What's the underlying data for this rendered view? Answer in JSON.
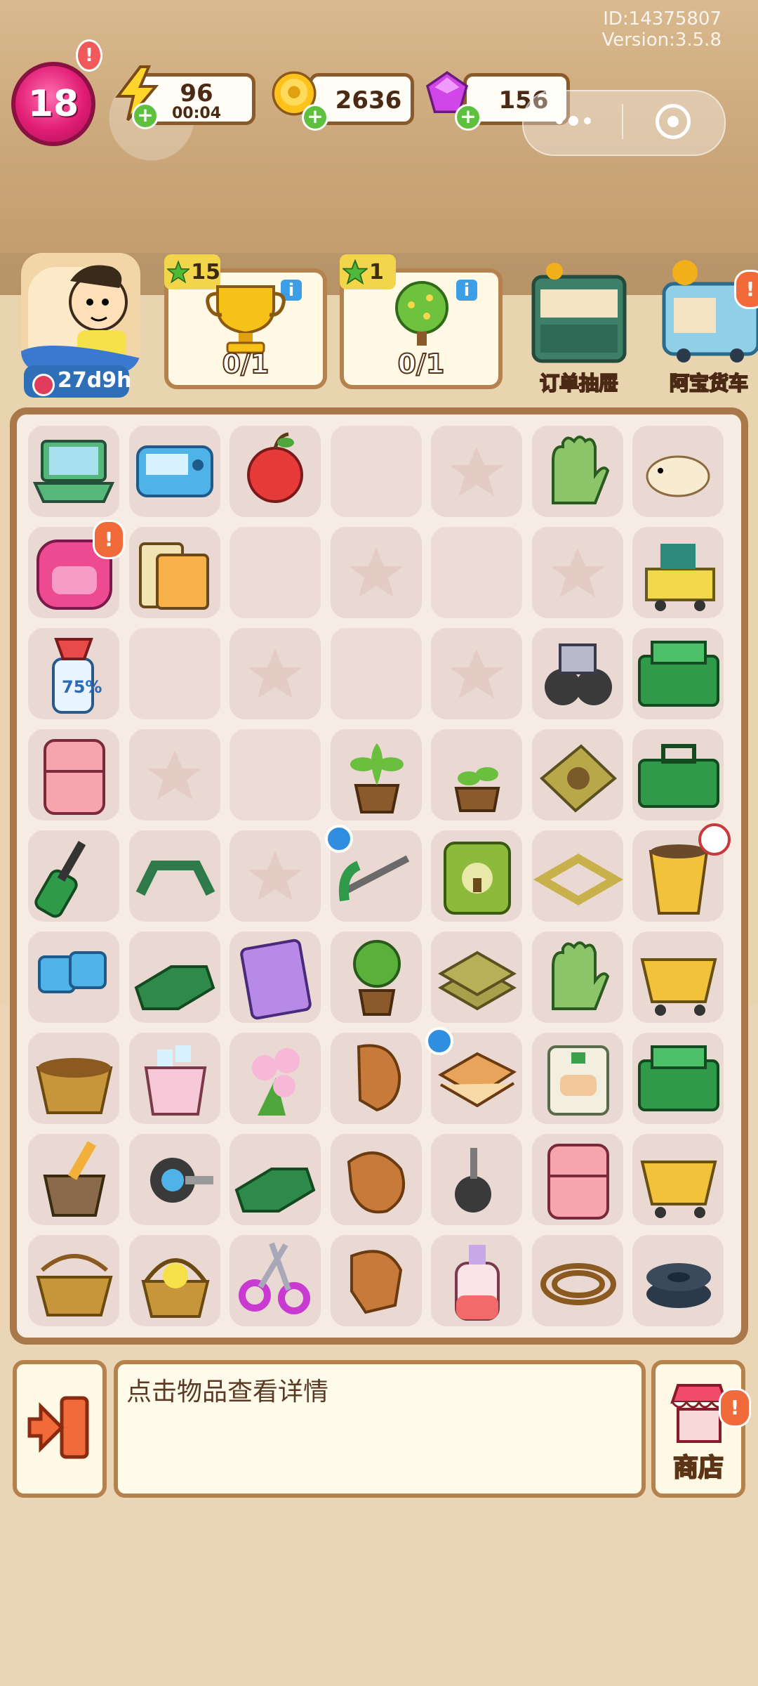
{
  "header": {
    "id_text": "ID:14375807",
    "version_text": "Version:3.5.8",
    "level": "18",
    "level_alert": "!",
    "energy": {
      "value": "96",
      "timer": "00:04"
    },
    "coins": {
      "value": "2636"
    },
    "gems": {
      "value": "156"
    }
  },
  "avatar": {
    "time_left": "27d9h"
  },
  "tasks": [
    {
      "stars": "15",
      "progress": "0/1",
      "info": "i"
    },
    {
      "stars": "1",
      "progress": "0/1",
      "info": "i"
    }
  ],
  "side_buttons": [
    {
      "label": "订单抽屉"
    },
    {
      "label": "阿宝货车",
      "alert": "!"
    }
  ],
  "board": {
    "rows": [
      [
        "laptop",
        "ice-machine",
        "apple",
        "empty",
        "star-slot",
        "gloves",
        "hamster"
      ],
      [
        "pink-backpack",
        "book-stack",
        "empty",
        "star-slot",
        "empty",
        "star-slot",
        "cart-tools"
      ],
      [
        "spray-bottle",
        "empty",
        "star-slot",
        "empty",
        "star-slot",
        "wheels",
        "green-toolbox-open"
      ],
      [
        "pink-fridge",
        "star-slot",
        "empty",
        "potted-plant",
        "sprout-pot",
        "seed-bag",
        "green-toolbox"
      ],
      [
        "screwdriver",
        "handle",
        "star-slot",
        "hacksaw",
        "seed-sack",
        "frame",
        "sprout-cup"
      ],
      [
        "blue-chip",
        "green-case",
        "sticker-book",
        "tree-pot",
        "seed-bag-stack",
        "gloves",
        "yellow-cart"
      ],
      [
        "basket",
        "ice-bucket",
        "flower-bouquet",
        "clay-pieces",
        "sandwich",
        "bandage-box",
        "green-toolbox-open"
      ],
      [
        "mortar",
        "ab-roller",
        "green-case",
        "clay-lump",
        "caster",
        "pink-fridge",
        "yellow-cart"
      ],
      [
        "basket-weave",
        "flower-basket",
        "scissors",
        "clay-broken",
        "lotion-bottle",
        "rope",
        "tire-pile"
      ]
    ],
    "badges": {
      "percent_label": "75%",
      "alert_mark": "!"
    }
  },
  "footer": {
    "info_text": "点击物品查看详情",
    "shop_label": "商店",
    "shop_alert": "!"
  },
  "colors": {
    "board_border": "#a8784a",
    "level_pink": "#e11d74",
    "plus_green": "#5fbf3f",
    "info_blue": "#3b9ee6"
  }
}
